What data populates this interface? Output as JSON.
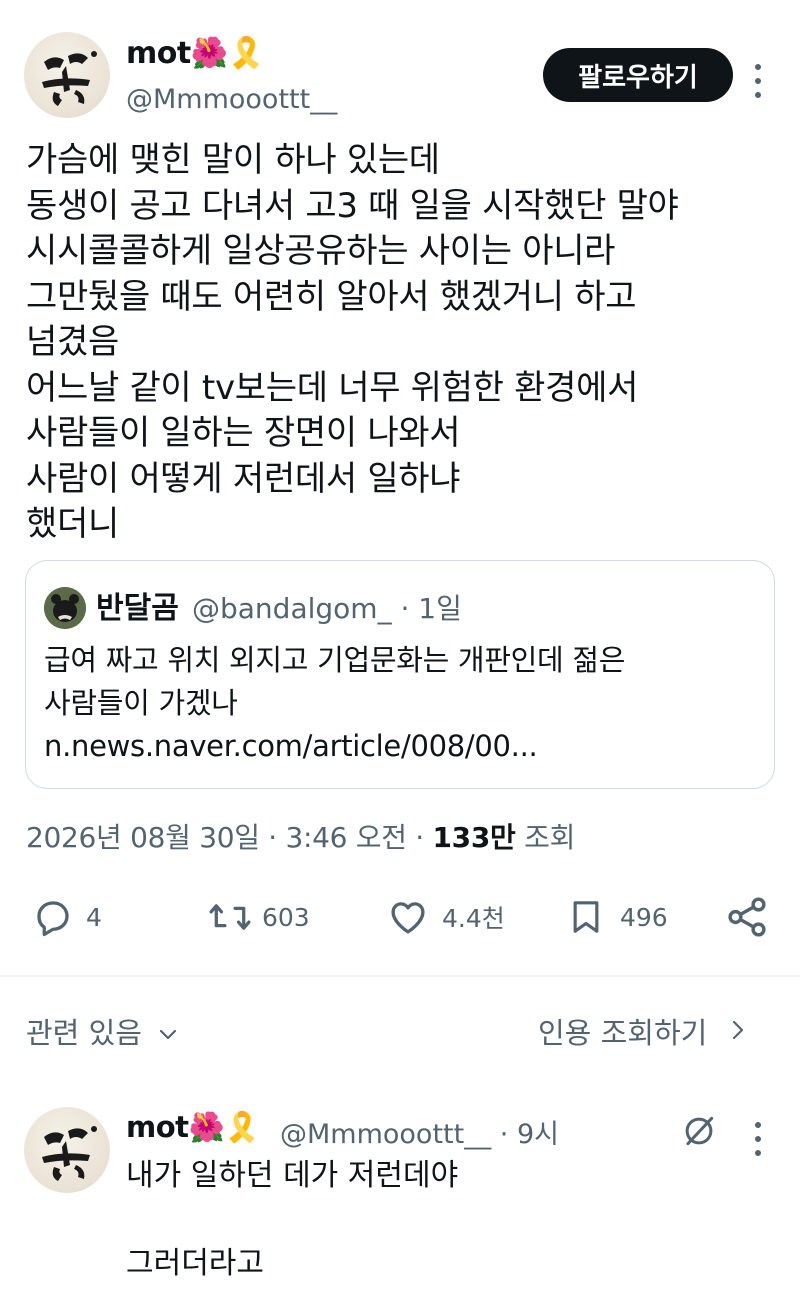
{
  "tweet": {
    "author_name": "mot🌺🎗️",
    "author_handle": "@Mmmooottt__",
    "follow_label": "팔로우하기",
    "body": "가슴에 맺힌 말이 하나 있는데\n동생이 공고 다녀서 고3 때 일을 시작했단 말야\n시시콜콜하게 일상공유하는 사이는 아니라\n그만뒀을 때도 어련히 알아서 했겠거니 하고\n넘겼음\n어느날 같이 tv보는데 너무 위험한 환경에서\n사람들이 일하는 장면이 나와서\n사람이 어떻게 저런데서 일하냐\n했더니",
    "quote": {
      "name": "반달곰",
      "handle_time": "@bandalgom_ · 1일",
      "text": "급여 짜고 위치 외지고 기업문화는 개판인데 젊은\n사람들이 가겠나\nn.news.naver.com/article/008/00..."
    },
    "timestamp": "2026년 08월 30일 · 3:46 오전 · ",
    "views_count": "133만",
    "views_label": " 조회",
    "stats": {
      "replies": "4",
      "retweets": "603",
      "likes": "4.4천",
      "bookmarks": "496"
    }
  },
  "related": {
    "label": "관련 있음",
    "quotes_link": "인용 조회하기"
  },
  "reply": {
    "author_name": "mot🌺🎗️",
    "handle_time": "@Mmmooottt__ · 9시",
    "body": "내가 일하던 데가 저런데야\n\n그러더라고"
  },
  "colors": {
    "text": "#0f1419",
    "secondary": "#536471",
    "border": "#cfd9de",
    "button_bg": "#0f1419"
  },
  "icons": [
    "reply-icon",
    "retweet-icon",
    "like-icon",
    "bookmark-icon",
    "share-icon",
    "more-icon",
    "chevron-down-icon",
    "chevron-right-icon",
    "grok-icon"
  ]
}
